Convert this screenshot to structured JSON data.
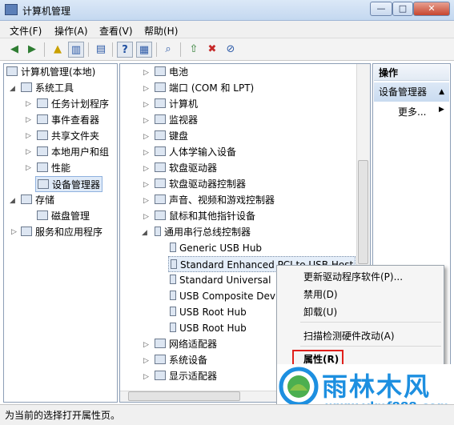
{
  "window": {
    "title": "计算机管理",
    "min": "—",
    "max": "□",
    "close": "✕"
  },
  "menu": [
    "文件(F)",
    "操作(A)",
    "查看(V)",
    "帮助(H)"
  ],
  "toolbar_icons": [
    "back-icon",
    "forward-icon",
    "up-folder-icon",
    "show-hide-tree-icon",
    "export-list-icon",
    "help-icon",
    "properties-icon",
    "scan-hardware-icon",
    "update-driver-icon",
    "uninstall-icon",
    "disable-icon"
  ],
  "left_tree": {
    "root": "计算机管理(本地)",
    "system_tools": "系统工具",
    "items": [
      "任务计划程序",
      "事件查看器",
      "共享文件夹",
      "本地用户和组",
      "性能",
      "设备管理器"
    ],
    "storage": "存储",
    "disk": "磁盘管理",
    "services": "服务和应用程序"
  },
  "device_tree": {
    "top": [
      "电池",
      "端口 (COM 和 LPT)",
      "计算机",
      "监视器",
      "键盘",
      "人体学输入设备",
      "软盘驱动器",
      "软盘驱动器控制器",
      "声音、视频和游戏控制器",
      "鼠标和其他指针设备"
    ],
    "usb_group": "通用串行总线控制器",
    "usb_items": [
      "Generic USB Hub",
      "Standard Enhanced PCI to USB Host",
      "Standard Universal",
      "USB Composite Dev",
      "USB Root Hub",
      "USB Root Hub"
    ],
    "bottom": [
      "网络适配器",
      "系统设备",
      "显示适配器"
    ]
  },
  "actions": {
    "header": "操作",
    "section": "设备管理器",
    "more": "更多..."
  },
  "context_menu": {
    "update": "更新驱动程序软件(P)...",
    "disable": "禁用(D)",
    "uninstall": "卸载(U)",
    "scan": "扫描检测硬件改动(A)",
    "properties": "属性(R)"
  },
  "status": "为当前的选择打开属性页。",
  "watermark": {
    "brand": "雨林木风",
    "url": "www.ylmf888.com"
  }
}
